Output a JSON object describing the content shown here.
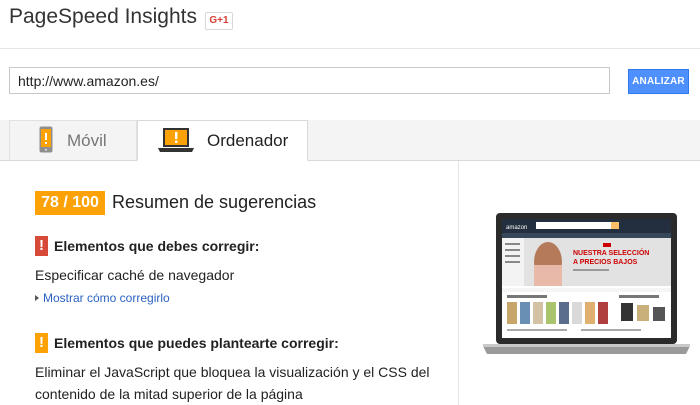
{
  "header": {
    "app_title": "PageSpeed Insights",
    "gplus_label": "G+1"
  },
  "search": {
    "url_value": "http://www.amazon.es/",
    "analyze_label": "ANALIZAR"
  },
  "tabs": [
    {
      "label": "Móvil",
      "icon": "phone-icon",
      "selected": false
    },
    {
      "label": "Ordenador",
      "icon": "laptop-icon",
      "selected": true
    }
  ],
  "summary": {
    "score": "78 / 100",
    "title": "Resumen de sugerencias"
  },
  "must_fix": {
    "title": "Elementos que debes corregir:",
    "alert_symbol": "!",
    "item": "Especificar caché de navegador",
    "link": "Mostrar cómo corregirlo"
  },
  "should_fix": {
    "title": "Elementos que puedes plantearte corregir:",
    "alert_symbol": "!",
    "item_line1": "Eliminar el JavaScript que bloquea la visualización y el CSS del",
    "item_line2": "contenido de la mitad superior de la página"
  },
  "preview": {
    "site_logo": "amazon",
    "banner_line1": "NUESTRA SELECCIÓN",
    "banner_line2": "A PRECIOS BAJOS"
  },
  "colors": {
    "score_orange": "#fca206",
    "alert_red": "#d84a38",
    "link_blue": "#2b62c3",
    "button_blue": "#4d90fe"
  }
}
